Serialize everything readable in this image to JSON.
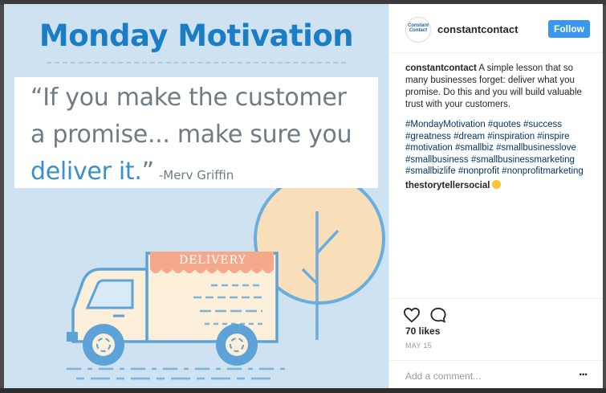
{
  "post_image": {
    "headline": "Monday Motivation",
    "quote_line1": "“If you make the customer",
    "quote_line2": "a promise... make sure you",
    "quote_accent": "deliver it.",
    "quote_close": "”",
    "attribution": "-Merv Griffin",
    "truck_label": "DELIVERY"
  },
  "header": {
    "avatar_text": "Constant Contact",
    "username": "constantcontact",
    "follow_label": "Follow"
  },
  "caption": {
    "author": "constantcontact",
    "text": "A simple lesson that so many businesses forget: deliver what you promise. Do this and you will build valuable trust with your customers.",
    "hashtags": "#MondayMotivation #quotes #success #greatness #dream #inspiration #inspire #motivation #smallbiz #smallbusinesslove #smallbusiness #smallbusinessmarketing #smallbizlife #nonprofit #nonprofitmarketing"
  },
  "comment": {
    "user": "thestorytellersocial",
    "emoji_icon": "smile-emoji"
  },
  "actions": {
    "heart_icon": "heart-icon",
    "comment_icon": "comment-icon"
  },
  "likes": "70 likes",
  "date": "MAY 15",
  "add_comment_placeholder": "Add a comment...",
  "more_label": "...",
  "colors": {
    "headline_blue": "#1b7dc4",
    "background_blue": "#cfe2f1",
    "follow_button": "#3897f0",
    "hashtag_link": "#003569",
    "awning_peach": "#f4a98c",
    "tree_peach": "#f8dfb9"
  }
}
